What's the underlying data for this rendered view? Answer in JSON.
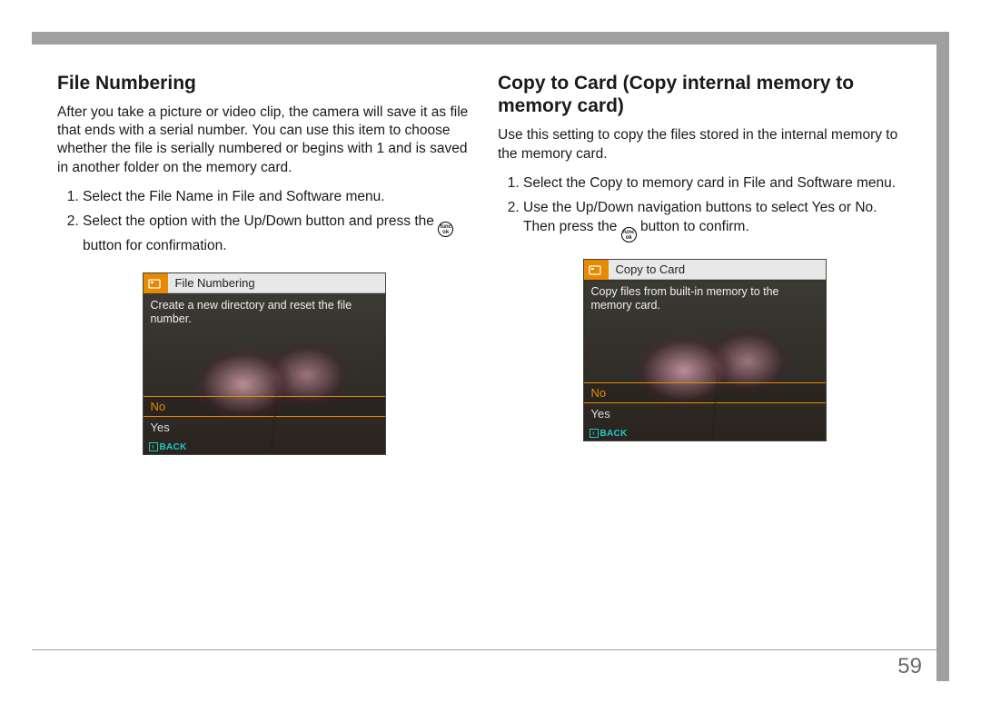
{
  "page_number": "59",
  "left": {
    "heading": "File Numbering",
    "paragraph": "After you take a picture or video clip, the camera will save it as file that ends with a serial number. You can use this item to choose whether the file is serially numbered or begins with 1 and is saved in another folder on the memory card.",
    "steps": [
      "Select the File Name in File and Software menu.",
      "Select the option with the Up/Down button and press the __FUNC__ button for confirmation."
    ],
    "screen": {
      "title": "File Numbering",
      "desc": "Create a new directory and reset the file number.",
      "option_selected": "No",
      "option_other": "Yes",
      "back": "BACK"
    }
  },
  "right": {
    "heading": "Copy to Card (Copy internal memory to memory card)",
    "paragraph": "Use this setting to copy the files stored in the internal memory to the memory card.",
    "steps": [
      "Select the Copy to memory card in File and Software menu.",
      "Use the Up/Down navigation buttons to select Yes or No. Then press the __FUNC__ button to confirm."
    ],
    "screen": {
      "title": "Copy to Card",
      "desc": "Copy files from built-in memory to the memory card.",
      "option_selected": "No",
      "option_other": "Yes",
      "back": "BACK"
    }
  }
}
